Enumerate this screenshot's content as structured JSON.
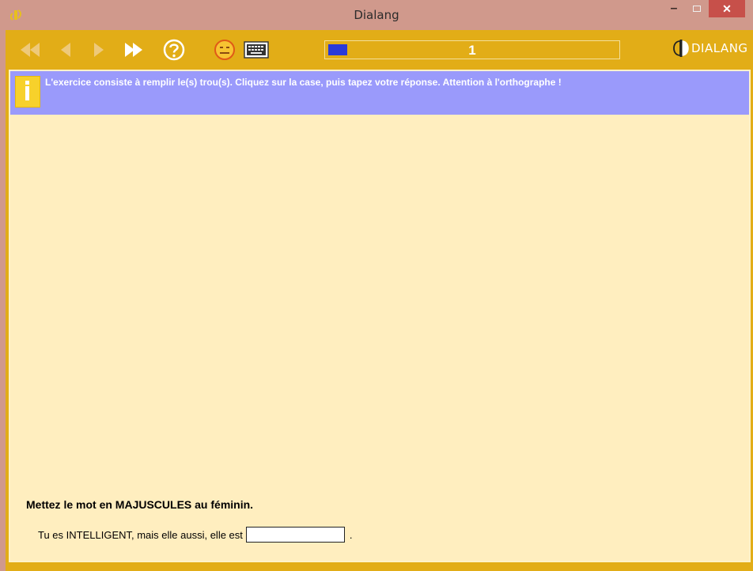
{
  "window": {
    "title": "Dialang"
  },
  "toolbar": {
    "buttons": [
      {
        "name": "first-icon",
        "state": "disabled"
      },
      {
        "name": "previous-icon",
        "state": "disabled"
      },
      {
        "name": "next-icon",
        "state": "disabled"
      },
      {
        "name": "fast-forward-icon",
        "state": "enabled"
      },
      {
        "name": "help-icon",
        "state": "enabled"
      },
      {
        "name": "feedback-smiley-icon",
        "state": "enabled"
      },
      {
        "name": "keyboard-icon",
        "state": "enabled"
      }
    ],
    "progress": {
      "current": "1",
      "fill_fraction": 0.06
    },
    "logo_text": "DIALANG"
  },
  "info": {
    "text": "L'exercice consiste à remplir le(s) trou(s). Cliquez sur la case, puis tapez votre réponse. Attention à l'orthographe !"
  },
  "exercise": {
    "instruction": "Mettez le mot en MAJUSCULES au féminin.",
    "sentence_before": "Tu es INTELLIGENT, mais elle aussi, elle est",
    "sentence_after": ".",
    "answer_value": ""
  },
  "colors": {
    "titlebar": "#d0998c",
    "frame": "#e2ad17",
    "content_bg": "#ffeebf",
    "info_bg": "#9a9afb",
    "progress_fill": "#2a3ad9",
    "close_button": "#c7504a"
  }
}
